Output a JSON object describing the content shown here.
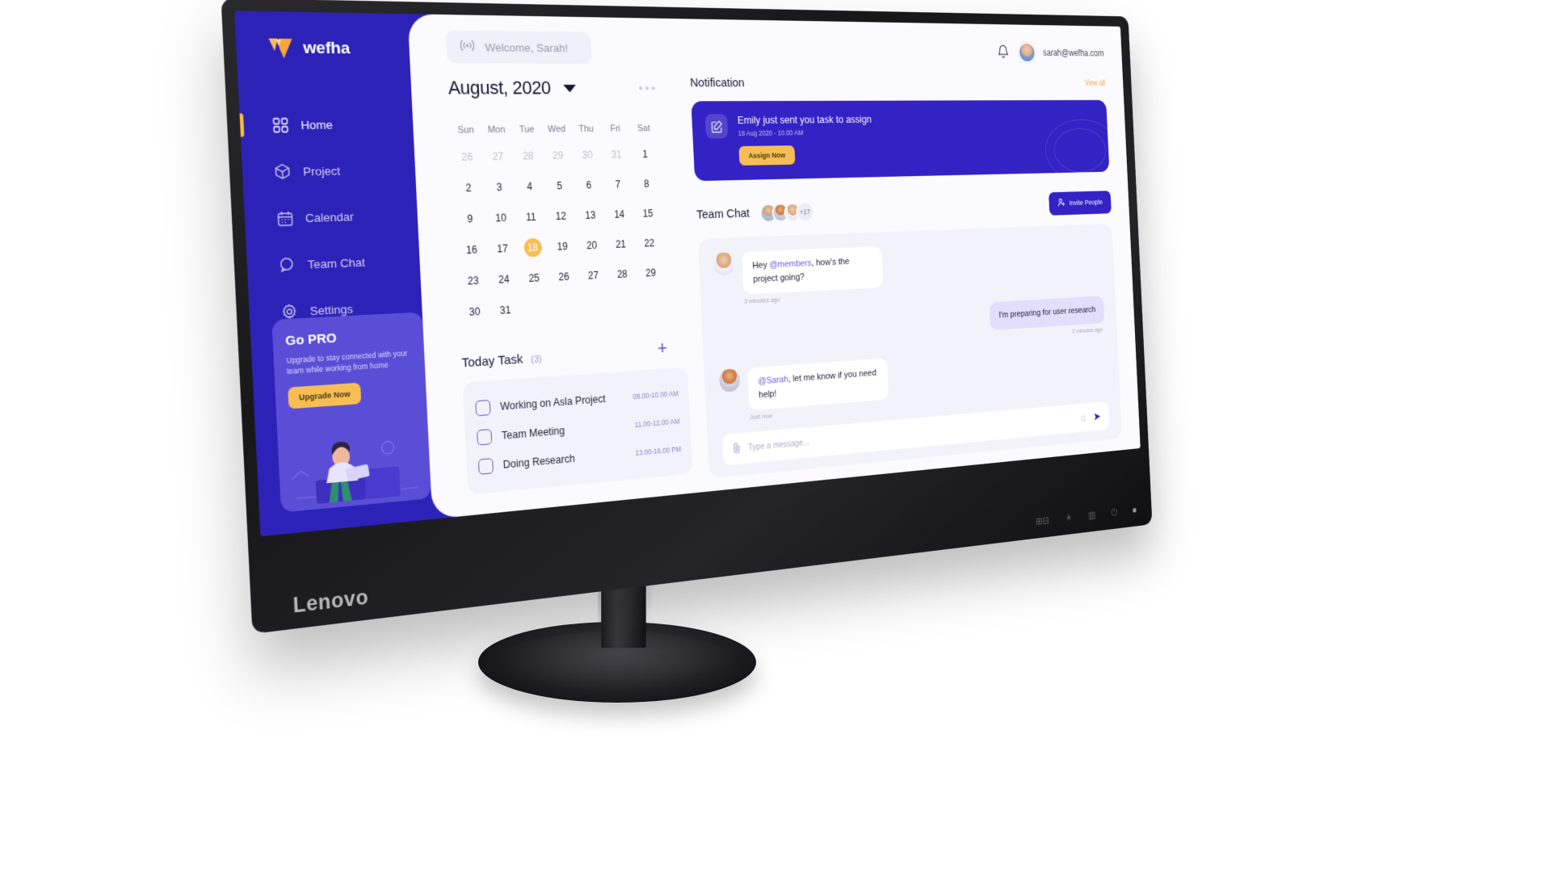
{
  "device": {
    "brand": "Lenovo",
    "power_led": "power-indicator"
  },
  "sidebar": {
    "logo_text": "wefha",
    "items": [
      {
        "label": "Home",
        "icon": "grid-icon",
        "active": true
      },
      {
        "label": "Project",
        "icon": "cube-icon",
        "active": false
      },
      {
        "label": "Calendar",
        "icon": "calendar-icon",
        "active": false
      },
      {
        "label": "Team Chat",
        "icon": "chat-bubble-icon",
        "active": false
      },
      {
        "label": "Settings",
        "icon": "gear-icon",
        "active": false
      }
    ],
    "gopro": {
      "title": "Go PRO",
      "description": "Upgrade to stay connected with your team while working from home",
      "button": "Upgrade Now"
    }
  },
  "topbar": {
    "welcome": "Welcome, Sarah!",
    "broadcast_icon": "broadcast-icon",
    "bell_icon": "bell-icon",
    "user_email": "sarah@wefha.com"
  },
  "calendar": {
    "month_label": "August, 2020",
    "caret_icon": "chevron-down-icon",
    "more_icon": "more-horizontal-icon",
    "dow": [
      "Sun",
      "Mon",
      "Tue",
      "Wed",
      "Thu",
      "Fri",
      "Sat"
    ],
    "days": [
      {
        "n": "26",
        "muted": true
      },
      {
        "n": "27",
        "muted": true
      },
      {
        "n": "28",
        "muted": true
      },
      {
        "n": "29",
        "muted": true
      },
      {
        "n": "30",
        "muted": true
      },
      {
        "n": "31",
        "muted": true
      },
      {
        "n": "1"
      },
      {
        "n": "2"
      },
      {
        "n": "3"
      },
      {
        "n": "4"
      },
      {
        "n": "5"
      },
      {
        "n": "6"
      },
      {
        "n": "7"
      },
      {
        "n": "8"
      },
      {
        "n": "9"
      },
      {
        "n": "10"
      },
      {
        "n": "11"
      },
      {
        "n": "12"
      },
      {
        "n": "13"
      },
      {
        "n": "14"
      },
      {
        "n": "15"
      },
      {
        "n": "16"
      },
      {
        "n": "17"
      },
      {
        "n": "18",
        "today": true
      },
      {
        "n": "19"
      },
      {
        "n": "20"
      },
      {
        "n": "21"
      },
      {
        "n": "22"
      },
      {
        "n": "23"
      },
      {
        "n": "24"
      },
      {
        "n": "25"
      },
      {
        "n": "26"
      },
      {
        "n": "27"
      },
      {
        "n": "28"
      },
      {
        "n": "29"
      },
      {
        "n": "30"
      },
      {
        "n": "31"
      }
    ]
  },
  "today_task": {
    "title": "Today Task",
    "count": "(3)",
    "add_icon": "plus-icon",
    "items": [
      {
        "label": "Working on Asla Project",
        "time": "08.00-10.00 AM",
        "checked": false
      },
      {
        "label": "Team Meeting",
        "time": "11.00-12.00 AM",
        "checked": false
      },
      {
        "label": "Doing Research",
        "time": "13.00-16.00 PM",
        "checked": false
      }
    ]
  },
  "notification": {
    "title": "Notification",
    "view_all": "View all",
    "card_icon": "compose-icon",
    "message": "Emily just sent you task to assign",
    "timestamp": "18 Aug 2020 - 10.00 AM",
    "button": "Assign Now"
  },
  "team_chat": {
    "title": "Team Chat",
    "extra_members": "+17",
    "invite_label": "Invite People",
    "invite_icon": "user-plus-icon",
    "messages": [
      {
        "direction": "in",
        "mention": "@members",
        "pre": "Hey ",
        "post": ", how's the project going?",
        "time": "3 minutes ago"
      },
      {
        "direction": "out",
        "pre": "I'm preparing for user research",
        "mention": "",
        "post": "",
        "time": "2 minutes ago"
      },
      {
        "direction": "in",
        "mention": "@Sarah",
        "pre": "",
        "post": ", let me know if you need help!",
        "time": "Just now"
      }
    ],
    "input_placeholder": "Type a message...",
    "attach_icon": "paperclip-icon",
    "emoji_icon": "emoji-icon",
    "send_icon": "send-icon"
  },
  "colors": {
    "brand_purple": "#2d22b8",
    "deep_purple": "#3322c4",
    "accent_amber": "#f7be55",
    "panel_bg": "#fafaff",
    "card_bg": "#f2f2fa"
  }
}
